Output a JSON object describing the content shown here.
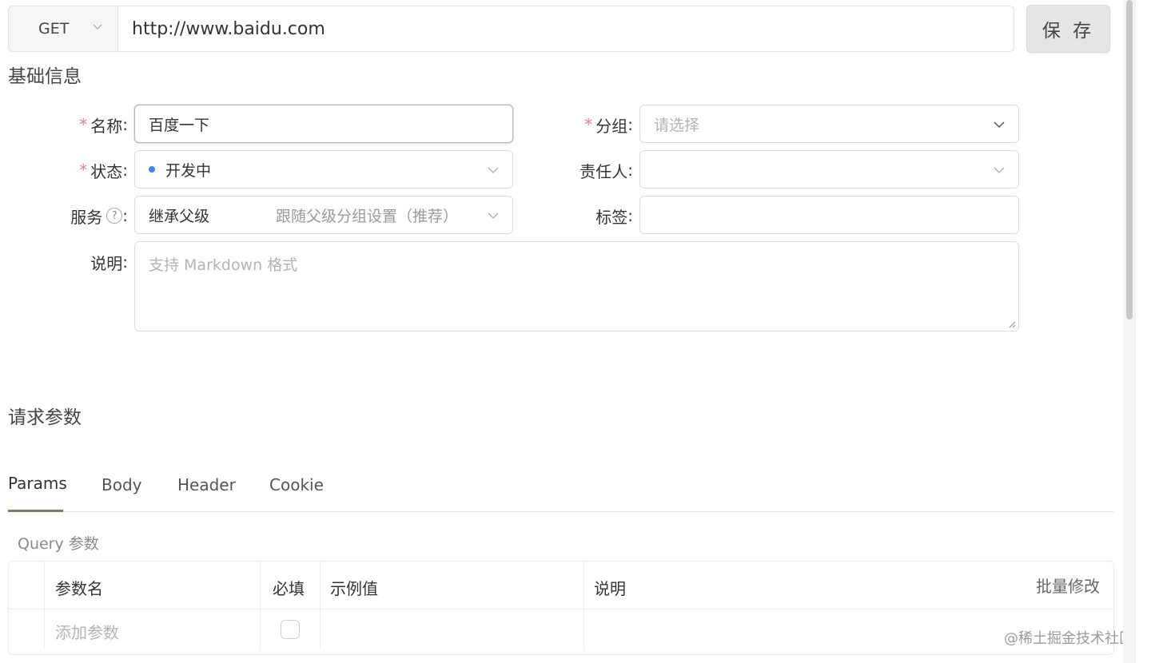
{
  "request": {
    "method": "GET",
    "url": "http://www.baidu.com",
    "save_label": "保 存"
  },
  "basic_info": {
    "title": "基础信息",
    "name": {
      "label": "名称",
      "value": "百度一下"
    },
    "group": {
      "label": "分组",
      "placeholder": "请选择"
    },
    "status": {
      "label": "状态",
      "value": "开发中",
      "dot_color": "#3b82f6"
    },
    "owner": {
      "label": "责任人",
      "value": ""
    },
    "service": {
      "label": "服务",
      "value": "继承父级",
      "hint": "跟随父级分组设置（推荐）"
    },
    "tags": {
      "label": "标签",
      "value": ""
    },
    "description": {
      "label": "说明",
      "placeholder": "支持 Markdown 格式"
    },
    "colon": ":"
  },
  "request_params": {
    "title": "请求参数",
    "tabs": [
      {
        "label": "Params",
        "active": true
      },
      {
        "label": "Body",
        "active": false
      },
      {
        "label": "Header",
        "active": false
      },
      {
        "label": "Cookie",
        "active": false
      }
    ],
    "query_label": "Query 参数",
    "table": {
      "columns": [
        "参数名",
        "必填",
        "示例值",
        "说明"
      ],
      "bulk_edit_label": "批量修改",
      "add_placeholder": "添加参数"
    }
  },
  "watermark": "@稀土掘金技术社区",
  "colors": {
    "accent_tab": "#7c7a6a",
    "required_star": "#e8799b",
    "border": "#dcdcdc"
  },
  "icons": [
    "chevron-down-icon",
    "help-circle-icon",
    "resize-handle-icon",
    "status-dot-icon"
  ]
}
